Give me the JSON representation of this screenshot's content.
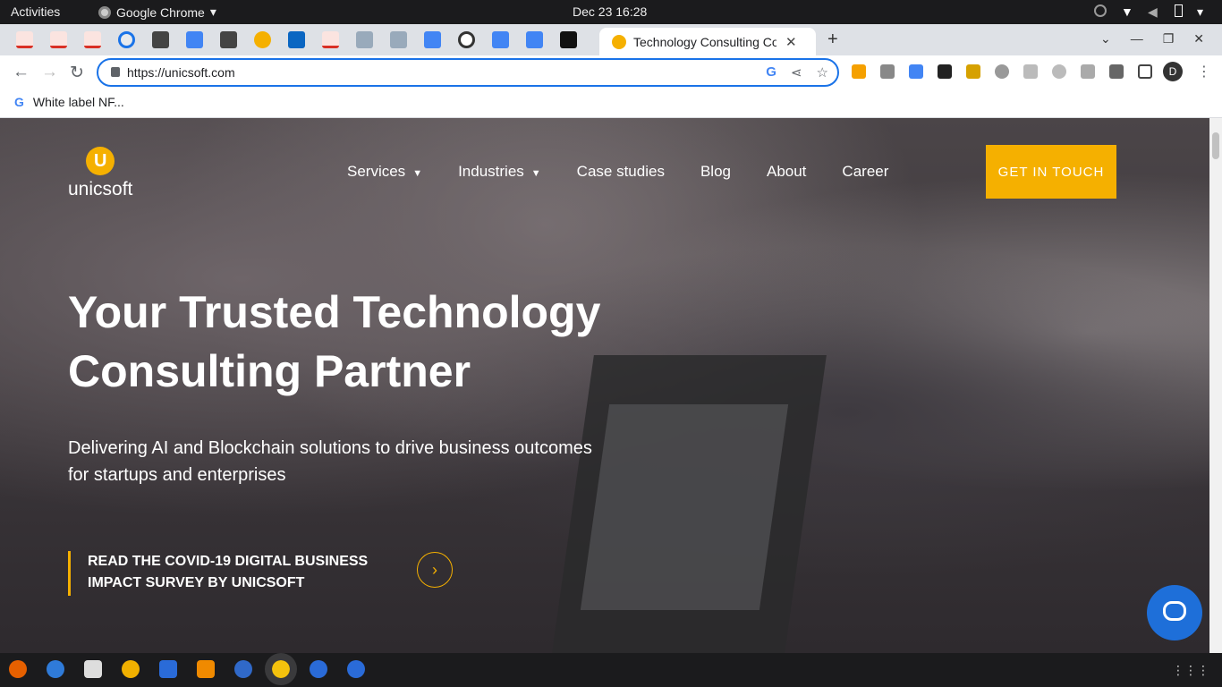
{
  "topbar": {
    "activities": "Activities",
    "app_name": "Google Chrome",
    "clock": "Dec 23  16:28"
  },
  "browser": {
    "active_tab_title": "Technology Consulting Co",
    "url": "https://unicsoft.com",
    "bookmark_label": "White label NF...",
    "profile_initial": "D"
  },
  "site": {
    "logo_text": "unicsoft",
    "logo_mark": "U",
    "nav": [
      {
        "label": "Services",
        "has_caret": true
      },
      {
        "label": "Industries",
        "has_caret": true
      },
      {
        "label": "Case studies",
        "has_caret": false
      },
      {
        "label": "Blog",
        "has_caret": false
      },
      {
        "label": "About",
        "has_caret": false
      },
      {
        "label": "Career",
        "has_caret": false
      }
    ],
    "cta": "GET IN TOUCH",
    "hero_title": "Your Trusted Technology Consulting Partner",
    "hero_subtitle": "Delivering AI and Blockchain solutions to drive business outcomes for startups and enterprises",
    "covid_link": "READ THE COVID-19 DIGITAL BUSINESS IMPACT SURVEY BY UNICSOFT",
    "accent_color": "#f5b000",
    "chat_color": "#1e6fd9"
  }
}
